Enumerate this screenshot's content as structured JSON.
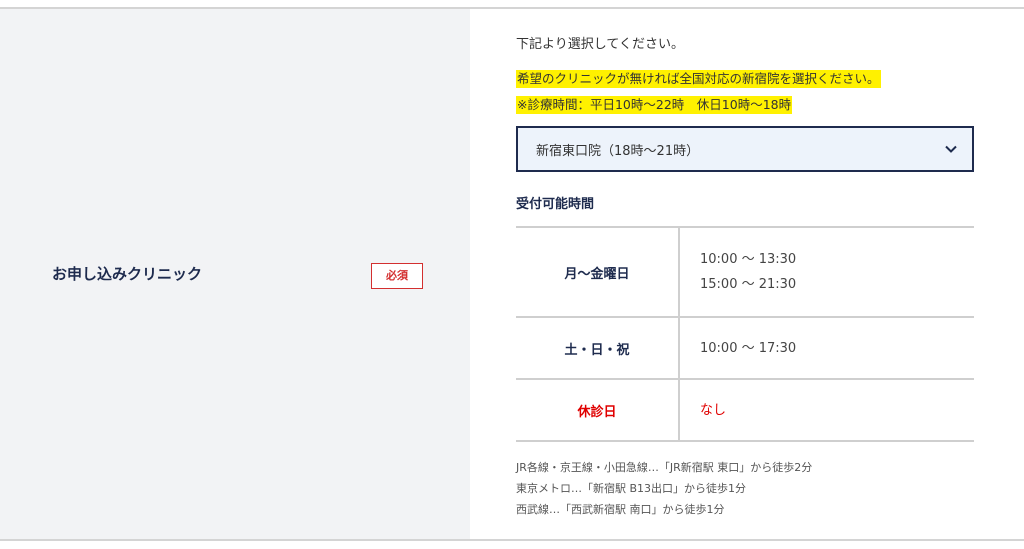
{
  "form": {
    "clinic_label": "お申し込みクリニック",
    "required_badge": "必須"
  },
  "content": {
    "instruction": "下記より選択してください。",
    "highlight_1": "希望のクリニックが無ければ全国対応の新宿院を選択ください。",
    "highlight_2": "※診療時間：平日10時〜22時　休日10時〜18時",
    "selected_clinic": "新宿東口院（18時〜21時）",
    "hours_title": "受付可能時間",
    "hours": [
      {
        "day": "月〜金曜日",
        "times": [
          "10:00 〜 13:30",
          "15:00 〜 21:30"
        ]
      },
      {
        "day": "土・日・祝",
        "times": [
          "10:00 〜 17:30"
        ]
      },
      {
        "day": "休診日",
        "times": [
          "なし"
        ]
      }
    ],
    "access": [
      "JR各線・京王線・小田急線…「JR新宿駅 東口」から徒歩2分",
      "東京メトロ…「新宿駅 B13出口」から徒歩1分",
      "西武線…「西武新宿駅 南口」から徒歩1分"
    ]
  },
  "colors": {
    "navy": "#1e2b4e",
    "required_red": "#d32f2f",
    "holiday_red": "#e00000",
    "highlight": "#fff100"
  },
  "icons": {
    "select_arrow": "chevron-down-icon"
  }
}
